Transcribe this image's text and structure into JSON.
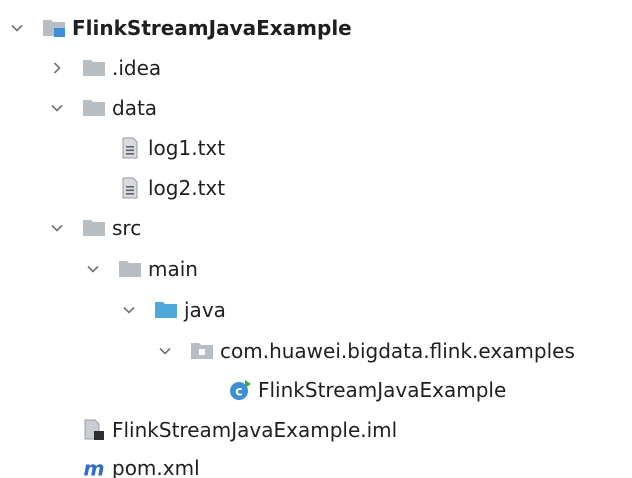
{
  "project_tree": {
    "root": {
      "label": "FlinkStreamJavaExample",
      "expanded": true,
      "icon": "project-folder-icon"
    },
    "idea": {
      "label": ".idea",
      "expanded": false,
      "icon": "folder-icon"
    },
    "data": {
      "label": "data",
      "expanded": true,
      "icon": "folder-icon"
    },
    "log1": {
      "label": "log1.txt",
      "icon": "text-file-icon"
    },
    "log2": {
      "label": "log2.txt",
      "icon": "text-file-icon"
    },
    "src": {
      "label": "src",
      "expanded": true,
      "icon": "folder-icon"
    },
    "main": {
      "label": "main",
      "expanded": true,
      "icon": "folder-icon"
    },
    "java": {
      "label": "java",
      "expanded": true,
      "icon": "source-folder-icon"
    },
    "package": {
      "label": "com.huawei.bigdata.flink.examples",
      "expanded": true,
      "icon": "package-icon"
    },
    "class": {
      "label": "FlinkStreamJavaExample",
      "icon": "java-class-icon"
    },
    "iml": {
      "label": "FlinkStreamJavaExample.iml",
      "icon": "module-file-icon"
    },
    "pom": {
      "label": "pom.xml",
      "icon": "maven-icon"
    }
  },
  "colors": {
    "folder": "#b8bcc3",
    "source_folder": "#4ea8dc",
    "chevron": "#6f737a",
    "class_icon": "#3b8fd6",
    "maven": "#2f6ec4"
  }
}
